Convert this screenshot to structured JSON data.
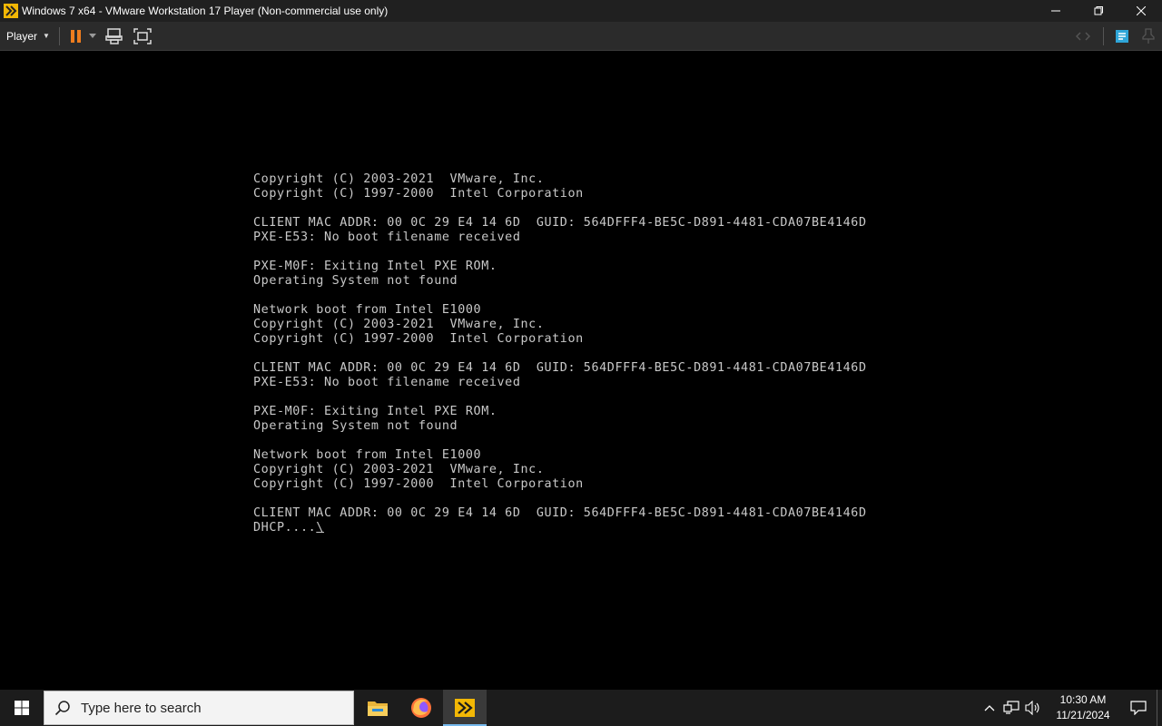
{
  "window": {
    "title": "Windows 7 x64 - VMware Workstation 17 Player (Non-commercial use only)",
    "controls": {
      "minimize": "–",
      "maximize": "□",
      "close": "✕"
    }
  },
  "toolbar": {
    "player_label": "Player",
    "icons": [
      "pause-icon",
      "dropdown-icon",
      "send-ctrl-alt-del-icon",
      "fullscreen-icon",
      "unity-icon",
      "library-icon",
      "message-log-icon"
    ]
  },
  "console": {
    "lines": [
      "Copyright (C) 2003-2021  VMware, Inc.",
      "Copyright (C) 1997-2000  Intel Corporation",
      "",
      "CLIENT MAC ADDR: 00 0C 29 E4 14 6D  GUID: 564DFFF4-BE5C-D891-4481-CDA07BE4146D",
      "PXE-E53: No boot filename received",
      "",
      "PXE-M0F: Exiting Intel PXE ROM.",
      "Operating System not found",
      "",
      "Network boot from Intel E1000",
      "Copyright (C) 2003-2021  VMware, Inc.",
      "Copyright (C) 1997-2000  Intel Corporation",
      "",
      "CLIENT MAC ADDR: 00 0C 29 E4 14 6D  GUID: 564DFFF4-BE5C-D891-4481-CDA07BE4146D",
      "PXE-E53: No boot filename received",
      "",
      "PXE-M0F: Exiting Intel PXE ROM.",
      "Operating System not found",
      "",
      "Network boot from Intel E1000",
      "Copyright (C) 2003-2021  VMware, Inc.",
      "Copyright (C) 1997-2000  Intel Corporation",
      "",
      "CLIENT MAC ADDR: 00 0C 29 E4 14 6D  GUID: 564DFFF4-BE5C-D891-4481-CDA07BE4146D"
    ],
    "last_line": "DHCP....",
    "cursor": "\\"
  },
  "taskbar": {
    "search_placeholder": "Type here to search",
    "apps": [
      "file-explorer-icon",
      "firefox-icon",
      "vmware-player-icon"
    ],
    "tray_icons": [
      "chevron-up-icon",
      "network-icon",
      "volume-icon"
    ],
    "time": "10:30 AM",
    "date": "11/21/2024"
  },
  "colors": {
    "titlebar": "#202020",
    "toolbar": "#2b2b2b",
    "console_text": "#c8c8c8",
    "taskbar": "#1c1c1c",
    "pause_orange": "#f07d1e",
    "vmware_yellow": "#f2b705"
  }
}
